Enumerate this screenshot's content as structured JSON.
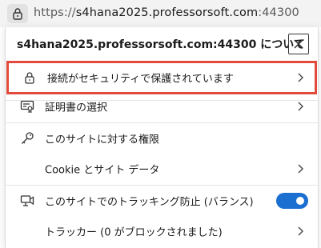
{
  "address_bar": {
    "scheme": "https://",
    "host": "s4hana2025.professorsoft.com",
    "port": ":44300",
    "lock_icon": "lock-icon"
  },
  "panel": {
    "title": "s4hana2025.professorsoft.com:44300 について",
    "close_icon": "close-icon",
    "items": [
      {
        "label": "接続がセキュリティで保護されています",
        "icon": "lock-icon",
        "chevron": true,
        "highlighted": true
      },
      {
        "label": "証明書の選択",
        "icon": "certificate-icon",
        "chevron": true
      },
      {
        "label": "このサイトに対する権限",
        "icon": "key-icon",
        "chevron": false
      },
      {
        "label": "Cookie とサイト データ",
        "icon": "",
        "chevron": true
      },
      {
        "label": "このサイトでのトラッキング防止 (バランス)",
        "icon": "tracking-prevention-icon",
        "toggle": true,
        "toggle_on": true
      },
      {
        "label": "トラッカー (0 がブロックされました)",
        "icon": "",
        "chevron": true
      }
    ]
  },
  "colors": {
    "highlight_border": "#e24b3b",
    "toggle_on": "#1a6fd1"
  }
}
